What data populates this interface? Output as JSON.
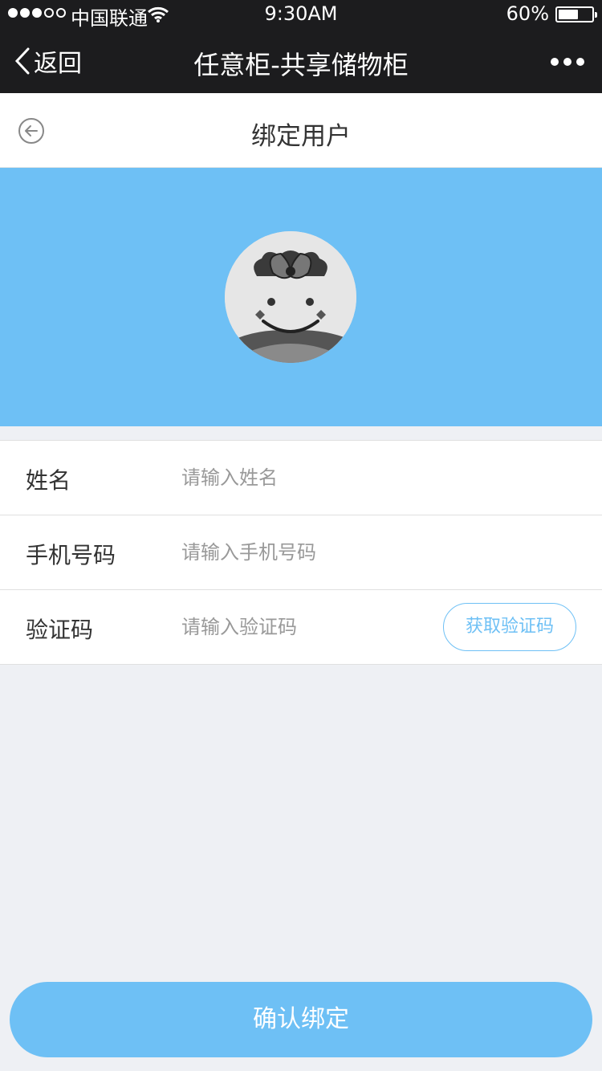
{
  "status_bar": {
    "carrier": "中国联通",
    "time": "9:30AM",
    "battery_percent": "60%",
    "battery_level": 0.6,
    "signal_dots_filled": 3,
    "signal_dots_total": 5
  },
  "nav_bar": {
    "back_label": "返回",
    "title": "任意柜-共享储物柜",
    "more_icon": "more-dots-icon"
  },
  "header": {
    "title": "绑定用户",
    "back_icon": "circle-arrow-left-icon"
  },
  "banner": {
    "color": "#6ec0f5",
    "avatar_icon": "avatar-sketch-face"
  },
  "form": {
    "name": {
      "label": "姓名",
      "placeholder": "请输入姓名",
      "value": ""
    },
    "phone": {
      "label": "手机号码",
      "placeholder": "请输入手机号码",
      "value": ""
    },
    "code": {
      "label": "验证码",
      "placeholder": "请输入验证码",
      "value": "",
      "button_label": "获取验证码"
    }
  },
  "confirm_button": {
    "label": "确认绑定"
  },
  "colors": {
    "accent": "#6ec0f5",
    "dark_bar": "#1c1c1e",
    "background": "#eef0f4"
  }
}
